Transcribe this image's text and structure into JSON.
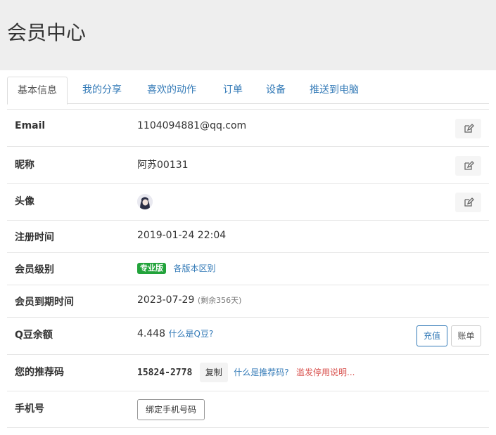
{
  "page": {
    "title": "会员中心"
  },
  "tabs": [
    {
      "label": "基本信息",
      "active": true
    },
    {
      "label": "我的分享"
    },
    {
      "label": "喜欢的动作"
    },
    {
      "label": "订单"
    },
    {
      "label": "设备"
    },
    {
      "label": "推送到电脑"
    }
  ],
  "fields": {
    "email": {
      "label": "Email",
      "value": "1104094881@qq.com"
    },
    "nickname": {
      "label": "昵称",
      "value": "阿苏00131"
    },
    "avatar": {
      "label": "头像"
    },
    "register": {
      "label": "注册时间",
      "value": "2019-01-24 22:04"
    },
    "level": {
      "label": "会员级别",
      "badge": "专业版",
      "link": "各版本区别"
    },
    "expire": {
      "label": "会员到期时间",
      "value": "2023-07-29",
      "remaining": "(剩余356天)"
    },
    "beans": {
      "label": "Q豆余额",
      "value": "4.448",
      "link": "什么是Q豆?",
      "recharge": "充值",
      "bill": "账单"
    },
    "referral": {
      "label": "您的推荐码",
      "code": "15824-2778",
      "copy": "复制",
      "link": "什么是推荐码?",
      "warning": "滥发停用说明..."
    },
    "phone": {
      "label": "手机号",
      "button": "绑定手机号码"
    }
  },
  "icons": {
    "edit": "edit-icon"
  },
  "colors": {
    "accent": "#337ab7",
    "badge": "#22a33b",
    "danger": "#d9534f",
    "header_bg": "#eeeeee"
  }
}
